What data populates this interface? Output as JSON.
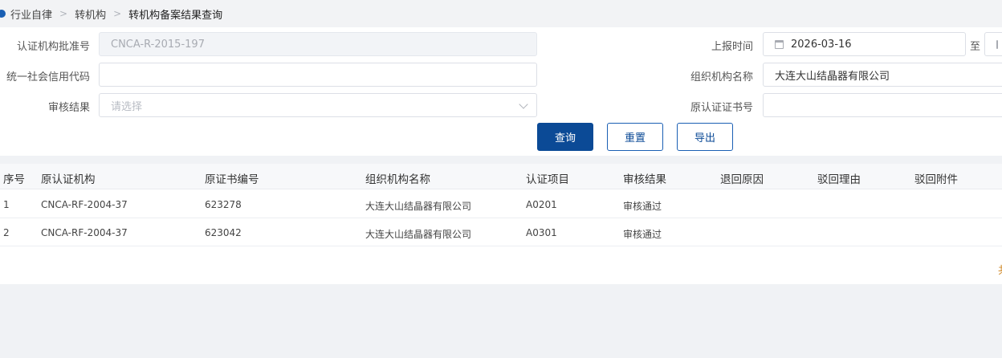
{
  "breadcrumb": {
    "items": [
      "行业自律",
      "转机构",
      "转机构备案结果查询"
    ]
  },
  "form": {
    "approval_no_label": "认证机构批准号",
    "approval_no_value": "CNCA-R-2015-197",
    "report_time_label": "上报时间",
    "report_time_start": "2026-03-16",
    "to_label": "至",
    "credit_code_label": "统一社会信用代码",
    "credit_code_value": "",
    "org_name_label": "组织机构名称",
    "org_name_value": "大连大山结晶器有限公司",
    "review_result_label": "审核结果",
    "review_result_placeholder": "请选择",
    "orig_cert_label": "原认证证书号",
    "orig_cert_value": ""
  },
  "buttons": {
    "query": "查询",
    "reset": "重置",
    "export": "导出"
  },
  "table": {
    "headers": [
      "序号",
      "原认证机构",
      "原证书编号",
      "组织机构名称",
      "认证项目",
      "审核结果",
      "退回原因",
      "驳回理由",
      "驳回附件"
    ],
    "rows": [
      [
        "1",
        "CNCA-RF-2004-37",
        "623278",
        "大连大山结晶器有限公司",
        "A0201",
        "审核通过",
        "",
        "",
        ""
      ],
      [
        "2",
        "CNCA-RF-2004-37",
        "623042",
        "大连大山结晶器有限公司",
        "A0301",
        "审核通过",
        "",
        "",
        ""
      ]
    ]
  },
  "pager": {
    "text": "共"
  },
  "colors": {
    "primary": "#0b4a96",
    "accent_text": "#d08a2a"
  }
}
